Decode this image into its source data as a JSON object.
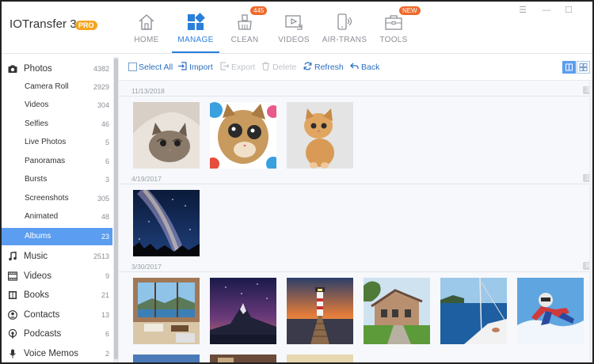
{
  "app": {
    "title": "IOTransfer 3",
    "edition_badge": "PRO"
  },
  "nav": {
    "items": [
      {
        "label": "HOME",
        "icon": "home-icon"
      },
      {
        "label": "MANAGE",
        "icon": "manage-icon",
        "active": true
      },
      {
        "label": "CLEAN",
        "icon": "clean-icon",
        "badge": "445"
      },
      {
        "label": "VIDEOS",
        "icon": "videos-icon"
      },
      {
        "label": "AIR-TRANS",
        "icon": "air-trans-icon"
      },
      {
        "label": "TOOLS",
        "icon": "tools-icon",
        "badge": "NEW"
      }
    ]
  },
  "window_controls": {
    "menu": "☰",
    "minimize": "—",
    "maximize": "☐"
  },
  "sidebar": {
    "items": [
      {
        "label": "Photos",
        "count": "4382",
        "icon": "camera-icon",
        "level": "top"
      },
      {
        "label": "Camera Roll",
        "count": "2929",
        "level": "sub"
      },
      {
        "label": "Videos",
        "count": "304",
        "level": "sub"
      },
      {
        "label": "Selfies",
        "count": "46",
        "level": "sub"
      },
      {
        "label": "Live Photos",
        "count": "5",
        "level": "sub"
      },
      {
        "label": "Panoramas",
        "count": "6",
        "level": "sub"
      },
      {
        "label": "Bursts",
        "count": "3",
        "level": "sub"
      },
      {
        "label": "Screenshots",
        "count": "305",
        "level": "sub"
      },
      {
        "label": "Animated",
        "count": "48",
        "level": "sub"
      },
      {
        "label": "Albums",
        "count": "23",
        "level": "sub",
        "active": true
      },
      {
        "label": "Music",
        "count": "2513",
        "icon": "music-icon",
        "level": "top"
      },
      {
        "label": "Videos",
        "count": "9",
        "icon": "film-icon",
        "level": "top"
      },
      {
        "label": "Books",
        "count": "21",
        "icon": "book-icon",
        "level": "top"
      },
      {
        "label": "Contacts",
        "count": "13",
        "icon": "contacts-icon",
        "level": "top"
      },
      {
        "label": "Podcasts",
        "count": "6",
        "icon": "podcast-icon",
        "level": "top"
      },
      {
        "label": "Voice Memos",
        "count": "2",
        "icon": "microphone-icon",
        "level": "top"
      }
    ]
  },
  "toolbar": {
    "select_all": "Select All",
    "import": "Import",
    "export": "Export",
    "delete": "Delete",
    "refresh": "Refresh",
    "back": "Back"
  },
  "sections": [
    {
      "date": "11/13/2018",
      "count": "3",
      "photos": [
        "kitten-under-blanket",
        "kitten-closeup",
        "kitten-sitting"
      ]
    },
    {
      "date": "4/19/2017",
      "count": "1",
      "photos": [
        "milky-way-night-sky"
      ]
    },
    {
      "date": "3/30/2017",
      "count": "9",
      "photos": [
        "lake-view-room",
        "mountain-at-night",
        "lighthouse-sunset",
        "stone-house",
        "sailboat-sea",
        "skydiver"
      ]
    }
  ],
  "colors": {
    "accent": "#2b7fd9",
    "sidebar_active": "#5b9df0",
    "pro_badge": "#f5a623",
    "nav_badge": "#ee6a2b"
  }
}
